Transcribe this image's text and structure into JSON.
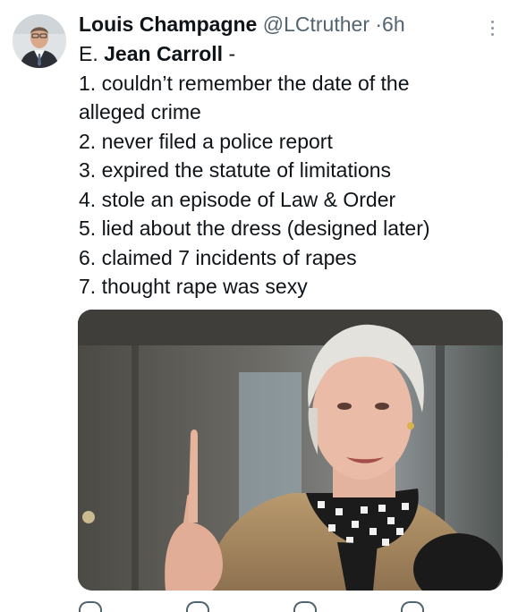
{
  "tweet": {
    "author": {
      "display_name": "Louis Champagne",
      "handle": "@LCtruther",
      "avatar_icon": "user-avatar-photo"
    },
    "separator": "·",
    "timestamp": "6h",
    "subject_prefix": "E.",
    "subject_name": "Jean Carroll",
    "subject_suffix": "-",
    "list_items": [
      "1. couldn’t remember the date of the",
      "alleged crime",
      "2. never filed a police report",
      "3. expired the statute of limitations",
      "4. stole an episode of Law & Order",
      "5. lied about the dress (designed later)",
      "6. claimed 7 incidents of rapes",
      "7. thought rape was sexy"
    ],
    "media": {
      "icon": "photo-of-woman-raising-finger"
    },
    "menu_icon": "more-vertical-icon"
  },
  "colors": {
    "text_primary": "#0f1419",
    "text_secondary": "#536471",
    "background": "#ffffff"
  }
}
